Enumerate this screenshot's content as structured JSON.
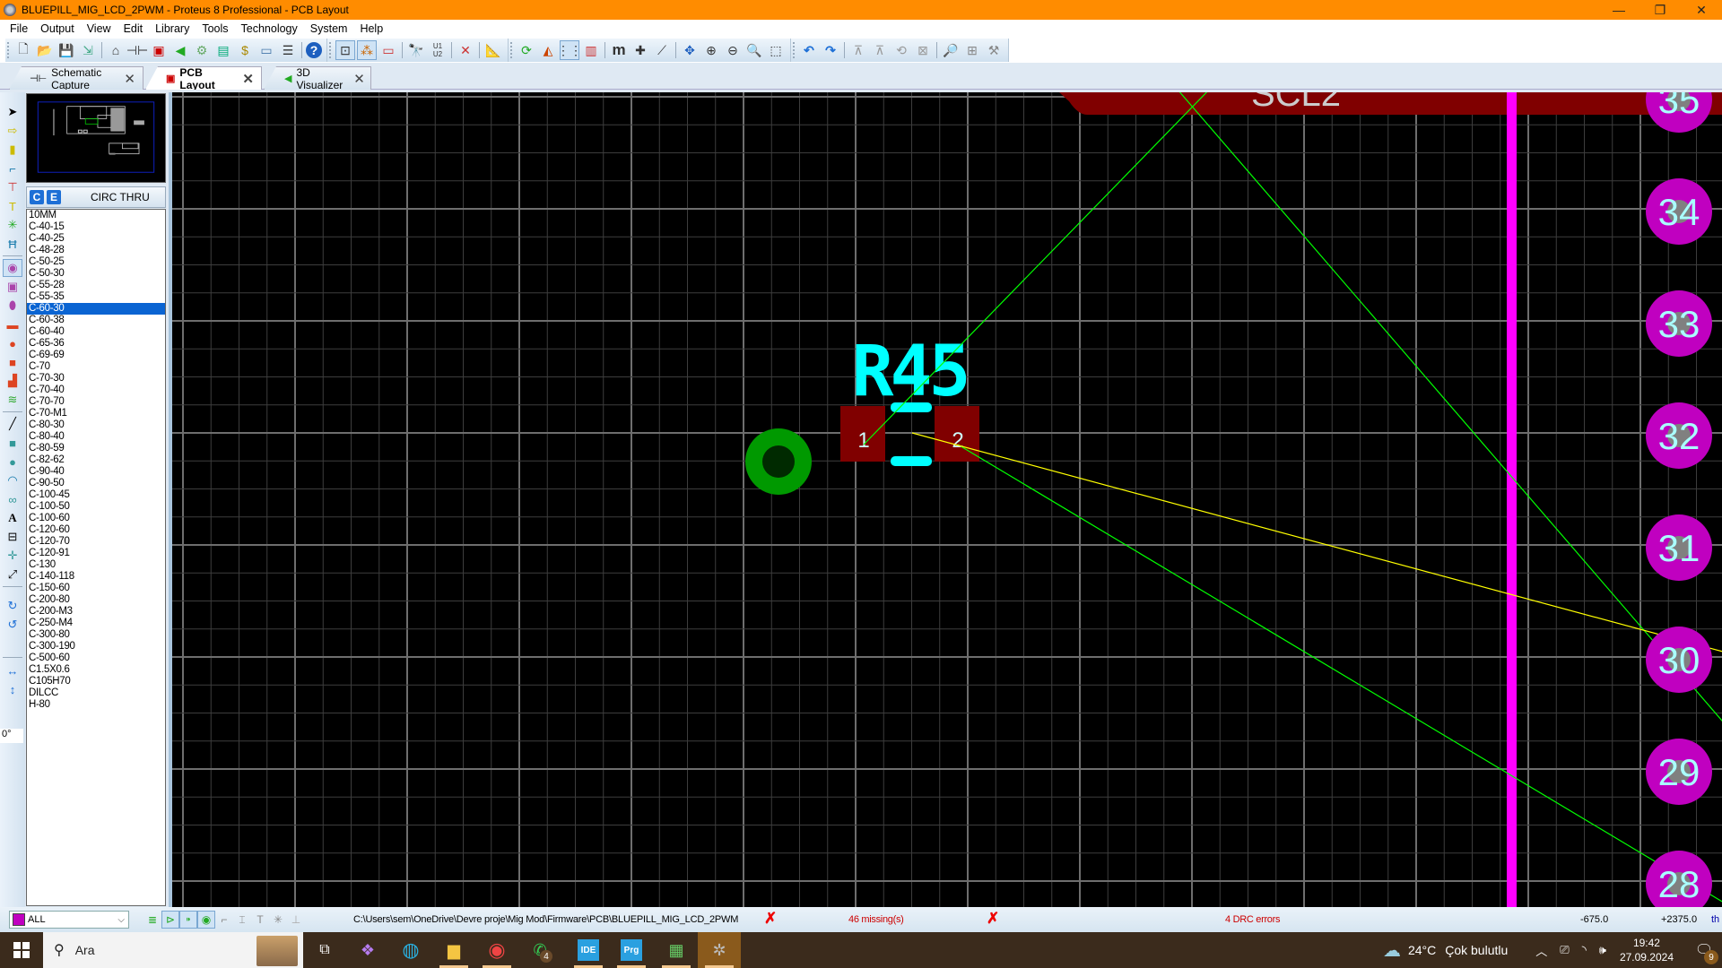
{
  "window": {
    "title": "BLUEPILL_MIG_LCD_2PWM - Proteus 8 Professional - PCB Layout",
    "controls": [
      "minimize",
      "restore",
      "close"
    ]
  },
  "menu": [
    "File",
    "Output",
    "View",
    "Edit",
    "Library",
    "Tools",
    "Technology",
    "System",
    "Help"
  ],
  "toolbar": {
    "file_group": [
      "new-file-icon",
      "open-file-icon",
      "save-icon",
      "import-icon"
    ],
    "nav_group": [
      "home-icon",
      "schematic-icon",
      "pcb-icon",
      "3d-visualizer-icon",
      "gerber-viewer-icon",
      "design-explorer-icon",
      "bom-icon",
      "notes-icon",
      "project-notes-icon",
      "help-icon"
    ],
    "edit_group": [
      "lock-icon",
      "snap-icon",
      "select-area-icon",
      "find-icon",
      "annotate-icon",
      "ratsnest-icon",
      "design-rules-icon"
    ],
    "view_group": [
      "refresh-icon",
      "flip-icon",
      "grid-icon",
      "layers-icon",
      "metric-icon",
      "origin-icon",
      "false-origin-icon",
      "pan-icon",
      "zoom-in-icon",
      "zoom-out-icon",
      "zoom-all-icon",
      "zoom-area-icon"
    ],
    "history_group": [
      "undo-icon",
      "redo-icon",
      "block-copy-icon",
      "block-move-icon",
      "block-rotate-icon",
      "block-delete-icon",
      "pick-part-icon",
      "make-package-icon",
      "decompose-icon"
    ]
  },
  "tabs": [
    {
      "label": "Schematic Capture",
      "icon": "schematic-icon",
      "active": false
    },
    {
      "label": "PCB Layout",
      "icon": "pcb-icon",
      "active": true
    },
    {
      "label": "3D Visualizer",
      "icon": "3d-icon",
      "active": false
    }
  ],
  "selector": {
    "btn_c": "C",
    "btn_e": "E",
    "title": "CIRC THRU",
    "items": [
      "10MM",
      "C-40-15",
      "C-40-25",
      "C-48-28",
      "C-50-25",
      "C-50-30",
      "C-55-28",
      "C-55-35",
      "C-60-30",
      "C-60-38",
      "C-60-40",
      "C-65-36",
      "C-69-69",
      "C-70",
      "C-70-30",
      "C-70-40",
      "C-70-70",
      "C-70-M1",
      "C-80-30",
      "C-80-40",
      "C-80-59",
      "C-82-62",
      "C-90-40",
      "C-90-50",
      "C-100-45",
      "C-100-50",
      "C-100-60",
      "C-120-60",
      "C-120-70",
      "C-120-91",
      "C-130",
      "C-140-118",
      "C-150-60",
      "C-200-80",
      "C-200-M3",
      "C-250-M4",
      "C-300-80",
      "C-300-190",
      "C-500-60",
      "C1.5X0.6",
      "C105H70",
      "DILCC",
      "H-80"
    ],
    "selected": "C-60-30"
  },
  "left_tools": {
    "angle": "0°"
  },
  "canvas": {
    "component_ref": "R45",
    "pad1_label": "1",
    "pad2_label": "2",
    "net_label": "SCL2",
    "pin_labels": [
      "35",
      "34",
      "33",
      "32",
      "31",
      "30",
      "29",
      "28"
    ],
    "colors": {
      "background": "#000000",
      "silkscreen": "#00ffff",
      "top_copper": "#800000",
      "via": "#009900",
      "ratsnest": "#00ff00",
      "force_vector": "#ffff00",
      "track": "#ff00ff",
      "pin_pad": "#c000c0",
      "pin_text": "#aaffff"
    }
  },
  "status": {
    "layer": "ALL",
    "path": "C:\\Users\\sem\\OneDrive\\Devre proje\\Mig Mod\\Firmware\\PCB\\BLUEPILL_MIG_LCD_2PWM",
    "missing": "46 missing(s)",
    "drc": "4 DRC errors",
    "x": "-675.0",
    "y": "+2375.0",
    "unit": "th"
  },
  "taskbar": {
    "search_placeholder": "Ara",
    "apps": [
      "task-view",
      "copilot",
      "edge",
      "file-explorer",
      "chrome",
      "whatsapp",
      "ide",
      "prg",
      "app-installer",
      "proteus"
    ],
    "whatsapp_badge": "4",
    "ide_label": "IDE",
    "prg_label": "Prg",
    "weather_temp": "24°C",
    "weather_desc": "Çok bulutlu",
    "time": "19:42",
    "date": "27.09.2024",
    "notifications": "9"
  }
}
